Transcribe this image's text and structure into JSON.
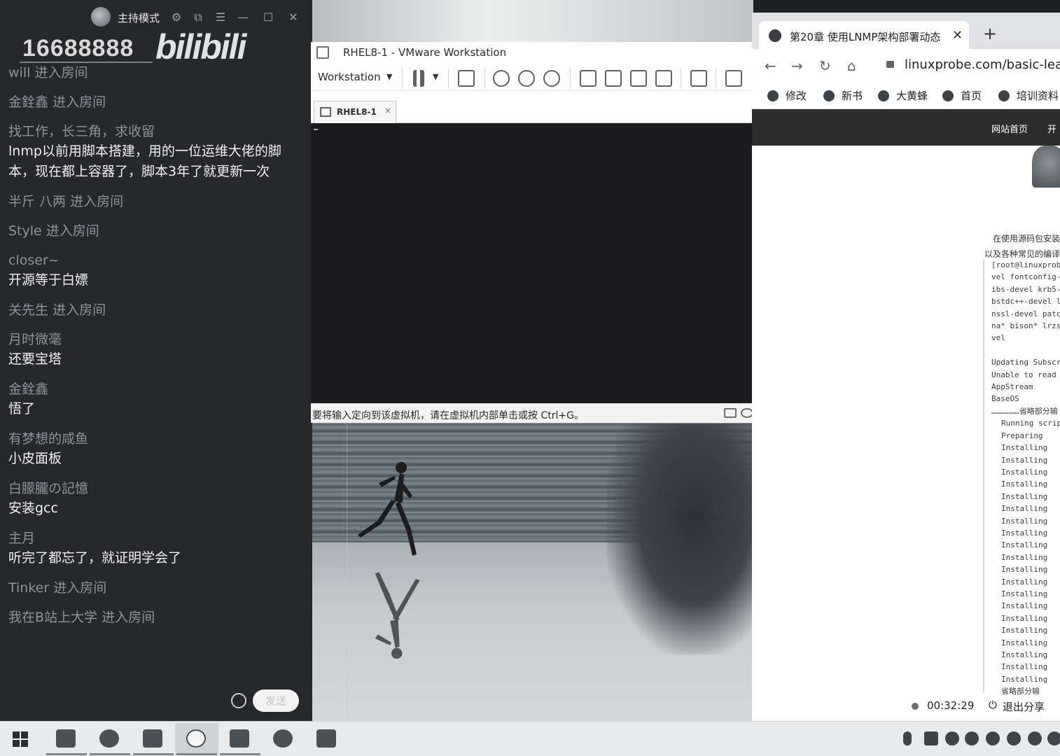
{
  "danmaku_panel": {
    "host_mode_label": "主持模式",
    "room_number": "16688888",
    "logo_text": "bilibili",
    "messages": [
      {
        "user": "will",
        "action": "进入房间",
        "text": ""
      },
      {
        "user": "金銓鑫",
        "action": "进入房间",
        "text": ""
      },
      {
        "user": "找工作，长三角，求收留",
        "action": "",
        "text": "lnmp以前用脚本搭建，用的一位运维大佬的脚本，现在都上容器了，脚本3年了就更新一次"
      },
      {
        "user": "半斤 八两",
        "action": "进入房间",
        "text": ""
      },
      {
        "user": "Style",
        "action": "进入房间",
        "text": ""
      },
      {
        "user": "closer~",
        "action": "",
        "text": "开源等于白嫖"
      },
      {
        "user": "关先生",
        "action": "进入房间",
        "text": ""
      },
      {
        "user": "月时微毫",
        "action": "",
        "text": "还要宝塔"
      },
      {
        "user": "金銓鑫",
        "action": "",
        "text": "悟了"
      },
      {
        "user": "有梦想的咸鱼",
        "action": "",
        "text": "小皮面板"
      },
      {
        "user": "白朦朧の記憶",
        "action": "",
        "text": "安装gcc"
      },
      {
        "user": "主月",
        "action": "",
        "text": "听完了都忘了，就证明学会了"
      },
      {
        "user": "Tinker",
        "action": "进入房间",
        "text": ""
      },
      {
        "user": "我在B站上大学",
        "action": "进入房间",
        "text": ""
      }
    ],
    "send_label": "发送"
  },
  "vmware": {
    "title": "RHEL8-1 - VMware Workstation",
    "menu_label": "Workstation",
    "tab_label": "RHEL8-1",
    "status_text": "要将输入定向到该虚拟机，请在虚拟机内部单击或按 Ctrl+G。"
  },
  "browser": {
    "tab_title": "第20章 使用LNMP架构部署动态",
    "url": "linuxprobe.com/basic-learn",
    "bookmarks": [
      "修改",
      "新书",
      "大黄蜂",
      "首页",
      "培训资料"
    ],
    "site_nav": [
      "网站首页",
      "开"
    ],
    "paragraphs": [
      "在使用源码包安装服",
      "以及各种常见的编译"
    ],
    "code_lines": [
      {
        "text": "[root@linuxprob",
        "indent": false
      },
      {
        "text": "vel fontconfig-",
        "indent": false
      },
      {
        "text": "ibs-devel krb5-",
        "indent": false
      },
      {
        "text": "bstdc++-devel l",
        "indent": false
      },
      {
        "text": "nssl-devel patc",
        "indent": false
      },
      {
        "text": "na* bison* lrzs",
        "indent": false
      },
      {
        "text": "vel",
        "indent": false
      },
      {
        "text": "",
        "indent": false
      },
      {
        "text": "Updating Subscr",
        "indent": false
      },
      {
        "text": "Unable to read",
        "indent": false
      },
      {
        "text": "AppStream",
        "indent": false
      },
      {
        "text": "BaseOS",
        "indent": false
      },
      {
        "text": "………………省略部分输",
        "indent": false
      },
      {
        "text": "Running scrip",
        "indent": true
      },
      {
        "text": "Preparing",
        "indent": true
      },
      {
        "text": "Installing",
        "indent": true
      },
      {
        "text": "Installing",
        "indent": true
      },
      {
        "text": "Installing",
        "indent": true
      },
      {
        "text": "Installing",
        "indent": true
      },
      {
        "text": "Installing",
        "indent": true
      },
      {
        "text": "Installing",
        "indent": true
      },
      {
        "text": "Installing",
        "indent": true
      },
      {
        "text": "Installing",
        "indent": true
      },
      {
        "text": "Installing",
        "indent": true
      },
      {
        "text": "Installing",
        "indent": true
      },
      {
        "text": "Installing",
        "indent": true
      },
      {
        "text": "Installing",
        "indent": true
      },
      {
        "text": "Installing",
        "indent": true
      },
      {
        "text": "Installing",
        "indent": true
      },
      {
        "text": "Installing",
        "indent": true
      },
      {
        "text": "Installing",
        "indent": true
      },
      {
        "text": "Installing",
        "indent": true
      },
      {
        "text": "Installing",
        "indent": true
      },
      {
        "text": "Installing",
        "indent": true
      },
      {
        "text": "Installing",
        "indent": true
      },
      {
        "text": "省略部分输",
        "indent": true
      }
    ]
  },
  "share_bar": {
    "timer": "00:32:29",
    "exit_label": "退出分享"
  }
}
